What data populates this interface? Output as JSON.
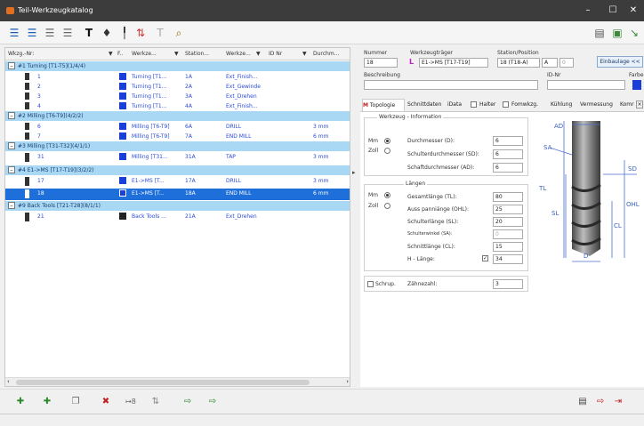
{
  "window": {
    "title": "Teil-Werkzeugkatalog",
    "min": "–",
    "max": "☐",
    "close": "✕"
  },
  "toolbar": {
    "text_tool": "T",
    "find_icon": "binoculars"
  },
  "table": {
    "headers": [
      "Wkzg.-Nr:",
      "F..",
      "Werkze...",
      "Station...",
      "Werkze...",
      "ID Nr",
      "Durchm..."
    ],
    "groups": [
      {
        "label": "#1 Turning [T1-T5](1/4/4)",
        "rows": [
          {
            "num": "1",
            "color": "#1a3ed8",
            "werkzeugtraeger": "Turning [T1...",
            "station": "1A",
            "name": "Ext_Finish...",
            "id": "",
            "dm": ""
          },
          {
            "num": "2",
            "color": "#1a3ed8",
            "werkzeugtraeger": "Turning [T1...",
            "station": "2A",
            "name": "Ext_Gewinde",
            "id": "",
            "dm": ""
          },
          {
            "num": "3",
            "color": "#1a3ed8",
            "werkzeugtraeger": "Turning [T1...",
            "station": "3A",
            "name": "Ext_Drehen",
            "id": "",
            "dm": ""
          },
          {
            "num": "4",
            "color": "#1a3ed8",
            "werkzeugtraeger": "Turning [T1...",
            "station": "4A",
            "name": "Ext_Finish...",
            "id": "",
            "dm": ""
          }
        ]
      },
      {
        "label": "#2 Milling [T6-T9](4/2/2)",
        "rows": [
          {
            "num": "6",
            "color": "#1a3ed8",
            "werkzeugtraeger": "Milling [T6-T9]",
            "station": "6A",
            "name": "DRILL",
            "id": "",
            "dm": "3 mm"
          },
          {
            "num": "7",
            "color": "#1a3ed8",
            "werkzeugtraeger": "Milling [T6-T9]",
            "station": "7A",
            "name": "END MILL",
            "id": "",
            "dm": "6 mm"
          }
        ]
      },
      {
        "label": "#3 Milling [T31-T32](4/1/1)",
        "rows": [
          {
            "num": "31",
            "color": "#1a3ed8",
            "werkzeugtraeger": "Milling [T31...",
            "station": "31A",
            "name": "TAP",
            "id": "",
            "dm": "3 mm"
          }
        ]
      },
      {
        "label": "#4 E1->MS [T17-T19](3/2/2)",
        "rows": [
          {
            "num": "17",
            "color": "#1a3ed8",
            "werkzeugtraeger": "E1->MS [T...",
            "station": "17A",
            "name": "DRILL",
            "id": "",
            "dm": "3 mm"
          },
          {
            "num": "18",
            "color": "#1a3ed8",
            "werkzeugtraeger": "E1->MS [T...",
            "station": "18A",
            "name": "END MILL",
            "id": "",
            "dm": "6 mm",
            "selected": true
          }
        ]
      },
      {
        "label": "#9 Back Tools [T21-T28](8/1/1)",
        "rows": [
          {
            "num": "21",
            "color": "#222222",
            "werkzeugtraeger": "Back Tools ...",
            "station": "21A",
            "name": "Ext_Drehen",
            "id": "",
            "dm": ""
          }
        ]
      }
    ]
  },
  "detail": {
    "nummer_label": "Nummer",
    "nummer": "18",
    "wt_label": "Werkzeugträger",
    "wt_value": "E1->MS [T17-T19]",
    "station_label": "Station/Position",
    "station_value": "18 (T18-A)",
    "station_pos": "A",
    "station_num": "0",
    "einbaulage": "Einbaulage <<",
    "beschreibung_label": "Beschreibung",
    "beschreibung": "",
    "idnr_label": "ID-Nr",
    "idnr": "",
    "farbe_label": "Farbe",
    "farbe": "#1a3ed8",
    "tabs": [
      "Topologie",
      "Schnittdaten",
      "iData",
      "Halter",
      "Fomwkzg.",
      "Kühlung",
      "Vermessung",
      "Komr"
    ],
    "wi_title": "Werkzeug - Information",
    "mm_label": "Mm",
    "zoll_label": "Zoll",
    "wi_fields": [
      {
        "label": "Durchmesser (D):",
        "value": "6"
      },
      {
        "label": "Schulterdurchmesser (SD):",
        "value": "6"
      },
      {
        "label": "Schaftdurchmesser (AD):",
        "value": "6"
      }
    ],
    "len_title": "Längen",
    "len_fields": [
      {
        "label": "Gesamtlänge (TL):",
        "value": "80"
      },
      {
        "label": "Auss panniänge (OHL):",
        "value": "25"
      },
      {
        "label": "Schulterlänge (SL):",
        "value": "20"
      },
      {
        "label": "Schulterwinkel (SA):",
        "value": "0"
      },
      {
        "label": "Schnittlänge (CL):",
        "value": "15"
      },
      {
        "label": "H - Länge:",
        "value": "34"
      }
    ],
    "schrup": "Schrup.",
    "zaehne_label": "Zähnezahl:",
    "zaehne": "3",
    "dim": {
      "ad": "AD",
      "sa": "SA",
      "sd": "SD",
      "tl": "TL",
      "sl": "SL",
      "ohl": "OHL",
      "cl": "CL",
      "d": "D"
    }
  }
}
